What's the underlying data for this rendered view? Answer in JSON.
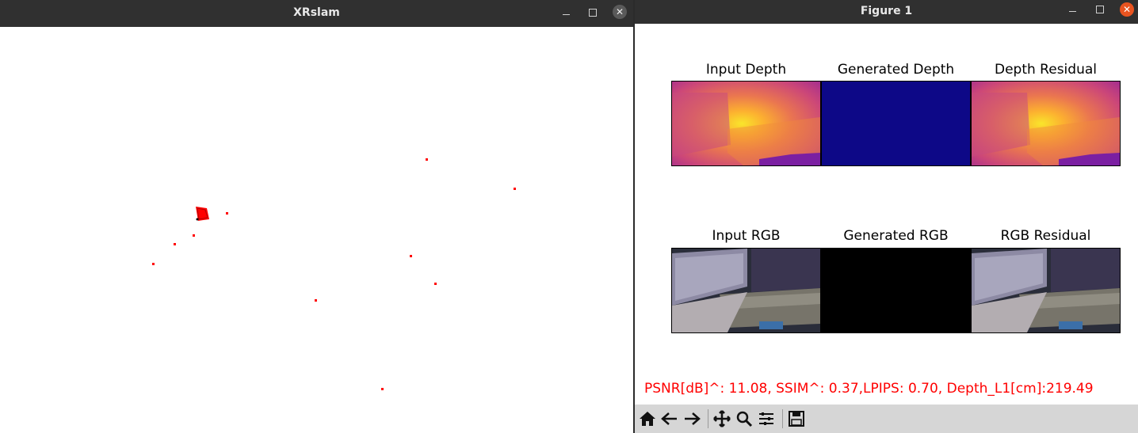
{
  "left_window": {
    "title": "XRslam",
    "close_glyph": "✕",
    "icons": [
      "minimize-icon",
      "maximize-icon",
      "close-icon"
    ]
  },
  "right_window": {
    "title": "Figure 1",
    "close_glyph": "✕",
    "icons": [
      "minimize-icon",
      "maximize-icon",
      "close-icon"
    ]
  },
  "figure": {
    "row1_titles": [
      "Input Depth",
      "Generated Depth",
      "Depth Residual"
    ],
    "row2_titles": [
      "Input RGB",
      "Generated RGB",
      "RGB Residual"
    ],
    "metrics": "PSNR[dB]^: 11.08, SSIM^: 0.37,LPIPS: 0.70, Depth_L1[cm]:219.49"
  },
  "toolbar": {
    "buttons": [
      "home-icon",
      "back-icon",
      "forward-icon",
      "pan-icon",
      "zoom-icon",
      "subplots-icon",
      "save-icon"
    ]
  },
  "colors": {
    "titlebar": "#303030",
    "close_orange": "#e95420",
    "point_red": "#ff0000",
    "generated_depth": "#0d0887"
  }
}
